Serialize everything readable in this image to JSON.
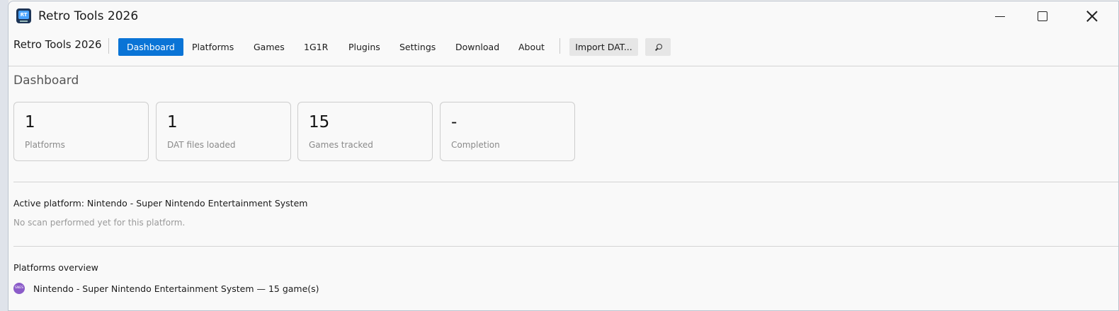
{
  "window": {
    "title": "Retro Tools 2026",
    "icon_text": "RT",
    "icon": "retro-tools-app-icon"
  },
  "toolbar": {
    "brand": "Retro Tools 2026",
    "nav": [
      {
        "label": "Dashboard",
        "active": true
      },
      {
        "label": "Platforms",
        "active": false
      },
      {
        "label": "Games",
        "active": false
      },
      {
        "label": "1G1R",
        "active": false
      },
      {
        "label": "Plugins",
        "active": false
      },
      {
        "label": "Settings",
        "active": false
      },
      {
        "label": "Download",
        "active": false
      },
      {
        "label": "About",
        "active": false
      }
    ],
    "import_label": "Import DAT...",
    "search_icon": "search-icon",
    "accent_color": "#0a74d6"
  },
  "dashboard": {
    "title": "Dashboard",
    "stats": [
      {
        "value": "1",
        "label": "Platforms"
      },
      {
        "value": "1",
        "label": "DAT files loaded"
      },
      {
        "value": "15",
        "label": "Games tracked"
      },
      {
        "value": "-",
        "label": "Completion"
      }
    ],
    "active_platform": "Active platform: Nintendo - Super Nintendo Entertainment System",
    "scan_status": "No scan performed yet for this platform.",
    "overview_title": "Platforms overview",
    "platforms": [
      {
        "badge": "SNES",
        "text": "Nintendo - Super Nintendo Entertainment System — 15 game(s)",
        "badge_color": "#8b5cc9"
      }
    ]
  }
}
